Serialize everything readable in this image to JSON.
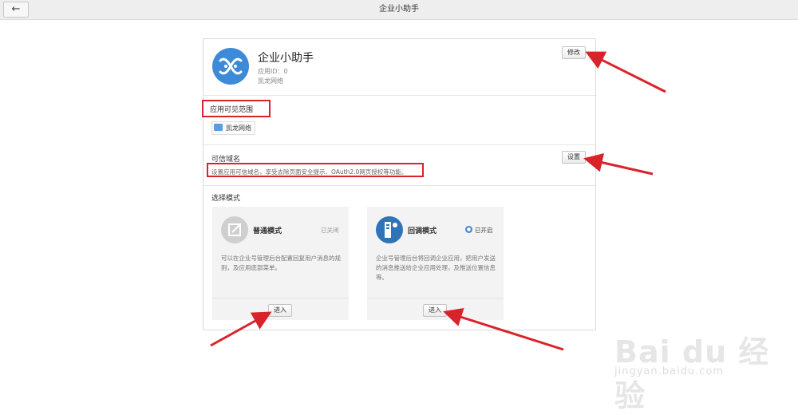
{
  "topbar": {
    "back_icon": "arrow-left-icon",
    "back_glyph": "←",
    "title": "企业小助手"
  },
  "app": {
    "name": "企业小助手",
    "id_label": "应用ID：0",
    "org": "凯龙网络",
    "edit_label": "修改",
    "logo_color": "#3d8bd8"
  },
  "scope": {
    "title": "应用可见范围",
    "dept": "凯龙网络"
  },
  "domain": {
    "title": "可信域名",
    "desc": "设置应用可信域名，享受去除页面安全提示、OAuth2.0网页授权等功能。",
    "set_label": "设置"
  },
  "modes": {
    "title": "选择模式",
    "normal": {
      "name": "普通模式",
      "status": "已关闭",
      "desc": "可以在企业号管理后台配置回复用户消息的规则，及应用底部菜单。",
      "enter_label": "进入"
    },
    "callback": {
      "name": "回调模式",
      "status": "已开启",
      "desc": "企业号管理后台将回调企业应用，把用户发送的消息推送给企业应用处理，及推送位置信息等。",
      "enter_label": "进入"
    }
  },
  "watermark": {
    "logo": "Bai du 经验",
    "url": "jingyan.baidu.com"
  },
  "colors": {
    "annotation_red": "#d9232a",
    "accent_blue": "#3d8bd8"
  }
}
